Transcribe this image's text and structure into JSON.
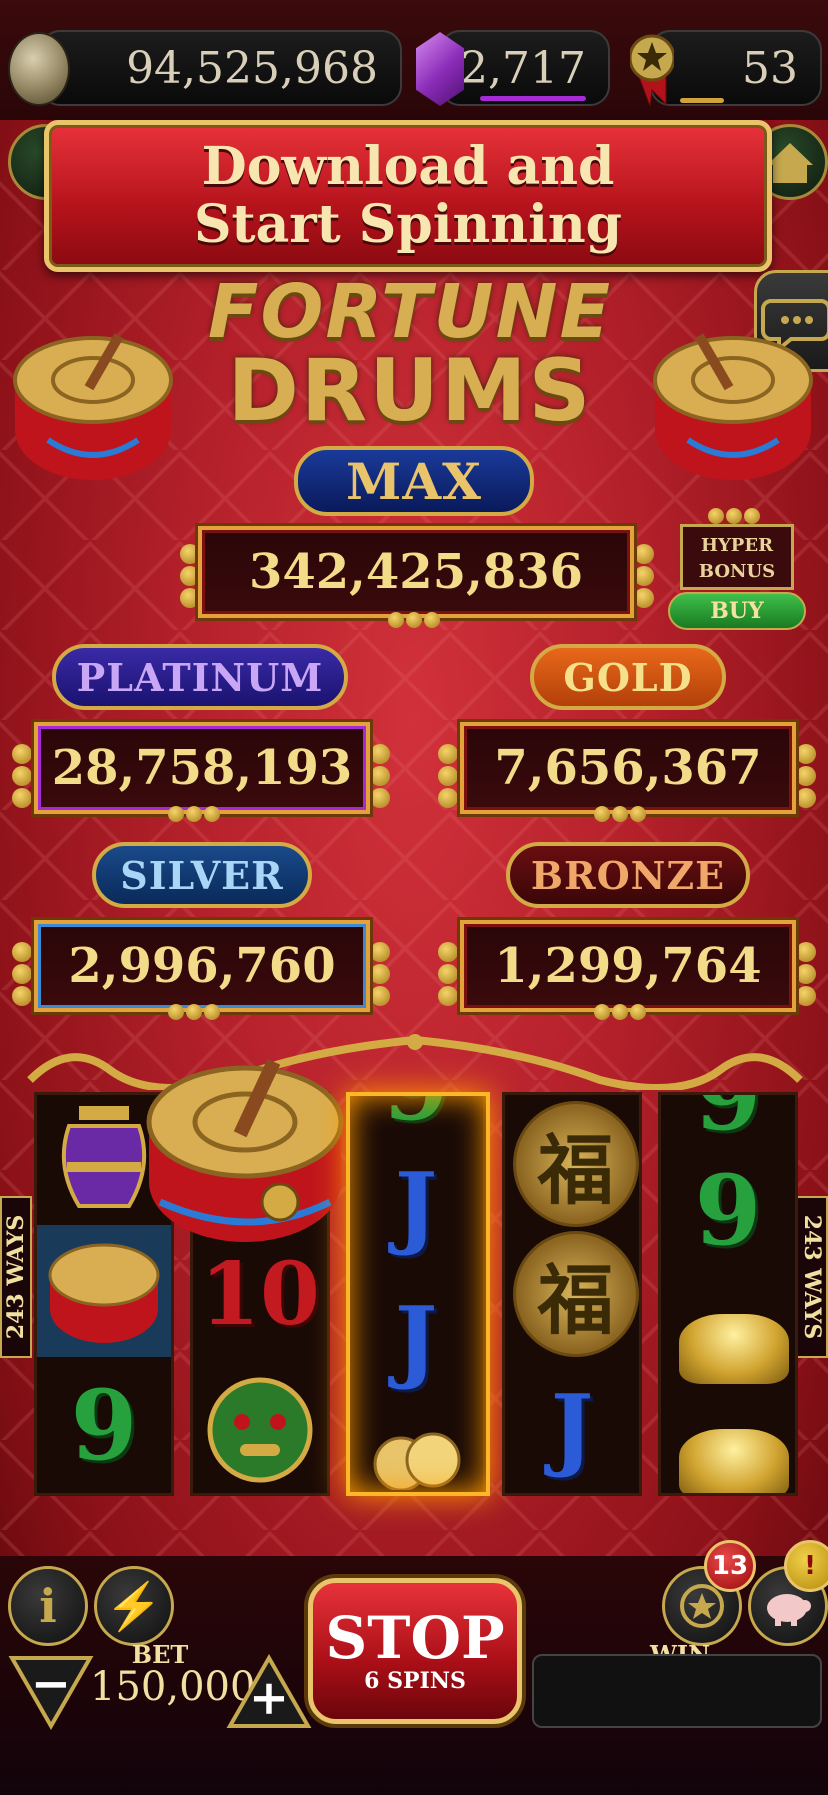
{
  "balance": {
    "coins": "94,525,968",
    "gems": "2,717",
    "level": "53"
  },
  "colors": {
    "gem_bar": "#a62bd6",
    "level_bar": "#d4a23a",
    "accent_gold": "#e9c46a",
    "banner_red": "#c61a22"
  },
  "banner": {
    "line1": "Download and",
    "line2": "Start Spinning"
  },
  "logo": {
    "line1": "FORTUNE",
    "line2": "DRUMS"
  },
  "jackpots": {
    "max": {
      "label": "MAX",
      "value": "342,425,836"
    },
    "platinum": {
      "label": "PLATINUM",
      "value": "28,758,193"
    },
    "gold": {
      "label": "GOLD",
      "value": "7,656,367"
    },
    "silver": {
      "label": "SILVER",
      "value": "2,996,760"
    },
    "bronze": {
      "label": "BRONZE",
      "value": "1,299,764"
    }
  },
  "hyper_bonus": {
    "line1": "HYPER",
    "line2": "BONUS",
    "buy": "BUY"
  },
  "ways": {
    "left": "243 WAYS",
    "right": "243 WAYS"
  },
  "reels": {
    "r1": [
      "vase",
      "drum",
      "9"
    ],
    "r2": [
      "drum",
      "10",
      "lion"
    ],
    "r3": [
      "9",
      "J",
      "J",
      "coins"
    ],
    "r4": [
      "福",
      "福",
      "J"
    ],
    "r5": [
      "9",
      "9",
      "ingot",
      "ingot"
    ]
  },
  "symbols": {
    "nine": "9",
    "ten": "10",
    "jack": "J",
    "fu": "福"
  },
  "icons": {
    "info": "i",
    "turbo": "⚡",
    "minus": "−",
    "plus": "+",
    "alert": "!"
  },
  "bottom": {
    "bet_label": "BET",
    "bet_value": "150,000",
    "stop": "STOP",
    "spins": "6 SPINS",
    "win_label": "WIN",
    "notifications": "13"
  }
}
